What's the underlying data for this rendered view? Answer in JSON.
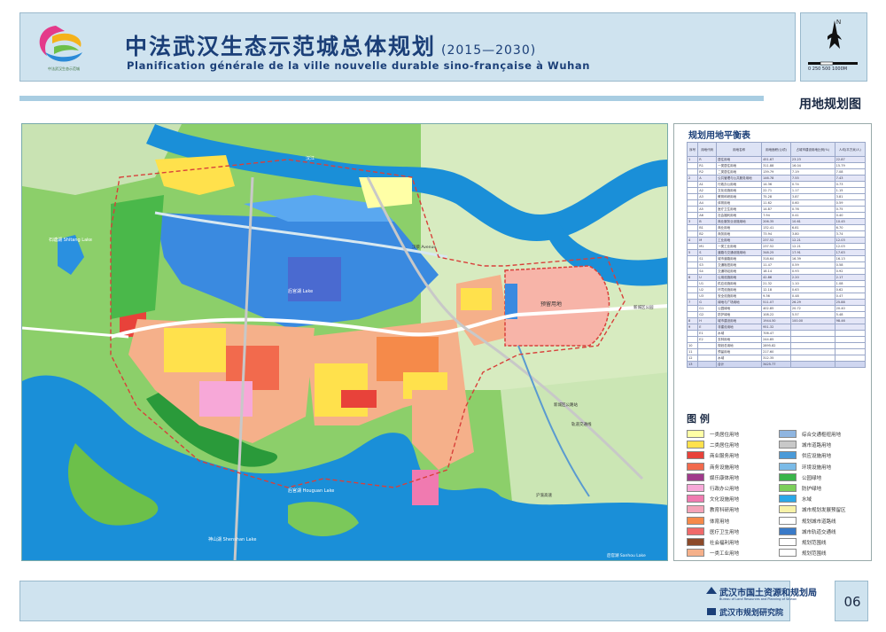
{
  "header": {
    "title_zh": "中法武汉生态示范城总体规划",
    "title_years": "(2015—2030)",
    "title_fr": "Planification générale de la ville nouvelle durable sino-française à Wuhan",
    "logo_caption": "中法武汉生态示范城",
    "scale_text": "0  250  500      1000M",
    "plan_title": "用地规划图"
  },
  "map": {
    "labels": {
      "lake_shitang": "石塘湖 Shitang Lake",
      "lake_middle": "后官湖 Lake",
      "zone_east": "预留用地",
      "lake_houguan": "后官湖 Houguan Lake",
      "lake_shenshan": "神山湖 Shenshan Lake",
      "lake_bottom_right": "后官湖 Sanhou Lake",
      "road_river": "汉江",
      "station_1": "新城区公园",
      "station_2": "新城区公路站",
      "metro": "轨道交通线",
      "avenue": "汉蔡 Avenue",
      "motorway": "沪渝高速"
    }
  },
  "table": {
    "title": "规划用地平衡表",
    "headers": [
      "序号",
      "用地代码",
      "用地名称",
      "用地面积(公顷)",
      "占城市建设用地比例(%)",
      "人均(平方米/人)"
    ],
    "rows": [
      {
        "no": "1",
        "code": "R",
        "name": "居住用地",
        "area": "451.67",
        "pct": "23.23",
        "per": "22.87",
        "cat": true
      },
      {
        "no": "",
        "code": "R1",
        "name": "一类居住用地",
        "area": "311.88",
        "pct": "16.04",
        "per": "15.79",
        "cat": false
      },
      {
        "no": "",
        "code": "R2",
        "name": "二类居住用地",
        "area": "139.79",
        "pct": "7.19",
        "per": "7.08",
        "cat": false
      },
      {
        "no": "2",
        "code": "A",
        "name": "公共管理与公共服务用地",
        "area": "146.78",
        "pct": "7.55",
        "per": "7.43",
        "cat": true
      },
      {
        "no": "",
        "code": "A1",
        "name": "行政办公用地",
        "area": "14.36",
        "pct": "0.74",
        "per": "0.73",
        "cat": false
      },
      {
        "no": "",
        "code": "A2",
        "name": "文化设施用地",
        "area": "22.71",
        "pct": "1.17",
        "per": "1.15",
        "cat": false
      },
      {
        "no": "",
        "code": "A3",
        "name": "教育科研用地",
        "area": "75.28",
        "pct": "3.87",
        "per": "3.81",
        "cat": false
      },
      {
        "no": "",
        "code": "A4",
        "name": "体育用地",
        "area": "11.62",
        "pct": "0.60",
        "per": "0.59",
        "cat": false
      },
      {
        "no": "",
        "code": "A5",
        "name": "医疗卫生用地",
        "area": "14.87",
        "pct": "0.76",
        "per": "0.75",
        "cat": false
      },
      {
        "no": "",
        "code": "A6",
        "name": "社会福利用地",
        "area": "7.94",
        "pct": "0.41",
        "per": "0.40",
        "cat": false
      },
      {
        "no": "3",
        "code": "B",
        "name": "商业服务业设施用地",
        "area": "206.35",
        "pct": "10.61",
        "per": "10.45",
        "cat": true
      },
      {
        "no": "",
        "code": "B1",
        "name": "商业用地",
        "area": "132.41",
        "pct": "6.81",
        "per": "6.70",
        "cat": false
      },
      {
        "no": "",
        "code": "B2",
        "name": "商务用地",
        "area": "73.94",
        "pct": "3.80",
        "per": "3.74",
        "cat": false
      },
      {
        "no": "4",
        "code": "M",
        "name": "工业用地",
        "area": "237.52",
        "pct": "12.21",
        "per": "12.03",
        "cat": true
      },
      {
        "no": "",
        "code": "M1",
        "name": "一类工业用地",
        "area": "237.52",
        "pct": "12.21",
        "per": "12.03",
        "cat": false
      },
      {
        "no": "5",
        "code": "S",
        "name": "道路与交通设施用地",
        "area": "348.25",
        "pct": "17.91",
        "per": "17.63",
        "cat": true
      },
      {
        "no": "",
        "code": "S1",
        "name": "城市道路用地",
        "area": "318.64",
        "pct": "16.39",
        "per": "16.13",
        "cat": false
      },
      {
        "no": "",
        "code": "S3",
        "name": "交通枢纽用地",
        "area": "11.47",
        "pct": "0.59",
        "per": "0.58",
        "cat": false
      },
      {
        "no": "",
        "code": "S4",
        "name": "交通场站用地",
        "area": "18.14",
        "pct": "0.93",
        "per": "0.92",
        "cat": false
      },
      {
        "no": "6",
        "code": "U",
        "name": "公用设施用地",
        "area": "42.86",
        "pct": "2.20",
        "per": "2.17",
        "cat": true
      },
      {
        "no": "",
        "code": "U1",
        "name": "供应设施用地",
        "area": "21.32",
        "pct": "1.10",
        "per": "1.08",
        "cat": false
      },
      {
        "no": "",
        "code": "U2",
        "name": "环境设施用地",
        "area": "12.18",
        "pct": "0.63",
        "per": "0.62",
        "cat": false
      },
      {
        "no": "",
        "code": "U3",
        "name": "安全设施用地",
        "area": "9.36",
        "pct": "0.48",
        "per": "0.47",
        "cat": false
      },
      {
        "no": "7",
        "code": "G",
        "name": "绿地与广场用地",
        "area": "511.07",
        "pct": "26.29",
        "per": "25.88",
        "cat": true
      },
      {
        "no": "",
        "code": "G1",
        "name": "公园绿地",
        "area": "402.85",
        "pct": "20.72",
        "per": "20.40",
        "cat": false
      },
      {
        "no": "",
        "code": "G2",
        "name": "防护绿地",
        "area": "108.22",
        "pct": "5.57",
        "per": "5.48",
        "cat": false
      },
      {
        "no": "8",
        "code": "H",
        "name": "城市建设用地",
        "area": "1944.50",
        "pct": "100.00",
        "per": "98.46",
        "cat": true
      },
      {
        "no": "9",
        "code": "E",
        "name": "非建设用地",
        "area": "951.32",
        "pct": "",
        "per": "",
        "cat": true
      },
      {
        "no": "",
        "code": "E1",
        "name": "水域",
        "area": "706.47",
        "pct": "",
        "per": "",
        "cat": false
      },
      {
        "no": "",
        "code": "E2",
        "name": "农林用地",
        "area": "244.85",
        "pct": "",
        "per": "",
        "cat": false
      },
      {
        "no": "10",
        "code": "",
        "name": "规划总用地",
        "area": "2895.82",
        "pct": "",
        "per": "",
        "cat": false
      },
      {
        "no": "11",
        "code": "",
        "name": "预留用地",
        "area": "217.60",
        "pct": "",
        "per": "",
        "cat": false
      },
      {
        "no": "12",
        "code": "",
        "name": "水域",
        "area": "312.35",
        "pct": "",
        "per": "",
        "cat": false
      },
      {
        "no": "13",
        "code": "",
        "name": "合计",
        "area": "3425.77",
        "pct": "",
        "per": "",
        "cat": true
      }
    ]
  },
  "legend": {
    "title": "图 例",
    "left": [
      {
        "label": "一类居住用地",
        "color": "#ffffa6"
      },
      {
        "label": "二类居住用地",
        "color": "#ffe14c"
      },
      {
        "label": "商业服务用地",
        "color": "#e8423a"
      },
      {
        "label": "商务设施用地",
        "color": "#f26a4d"
      },
      {
        "label": "娱乐康体用地",
        "color": "#a03a8c"
      },
      {
        "label": "行政办公用地",
        "color": "#f7a8d8"
      },
      {
        "label": "文化设施用地",
        "color": "#f07ab0"
      },
      {
        "label": "教育科研用地",
        "color": "#f4a3b8"
      },
      {
        "label": "体育用地",
        "color": "#f58a4a"
      },
      {
        "label": "医疗卫生用地",
        "color": "#f06a6a"
      },
      {
        "label": "社会福利用地",
        "color": "#8c4a2a"
      },
      {
        "label": "一类工业用地",
        "color": "#f5b08a"
      }
    ],
    "right": [
      {
        "label": "综合交通枢纽用地",
        "color": "#8fb5e0"
      },
      {
        "label": "城市道路用地",
        "color": "#c8c8c8"
      },
      {
        "label": "供应设施用地",
        "color": "#4a9ad8"
      },
      {
        "label": "环境设施用地",
        "color": "#7abbe8"
      },
      {
        "label": "公园绿地",
        "color": "#3ab54a"
      },
      {
        "label": "防护绿地",
        "color": "#7ccf5a"
      },
      {
        "label": "水域",
        "color": "#2aa8e8"
      },
      {
        "label": "城市规划发展预留区",
        "color": "#f7f2a8"
      },
      {
        "label": "规划城市道路线",
        "color": "#ffffff"
      },
      {
        "label": "城市轨道交通线",
        "color": "#3a7ac8"
      },
      {
        "label": "规划范围线",
        "color": "#ffffff"
      },
      {
        "label": "规划范围线",
        "color": "#ffffff"
      }
    ]
  },
  "footer": {
    "org1": "武汉市国土资源和规划局",
    "org1_sub": "Bureau of Land Resources and Planning of Wuhan",
    "org2": "武汉市规划研究院",
    "page": "06"
  }
}
